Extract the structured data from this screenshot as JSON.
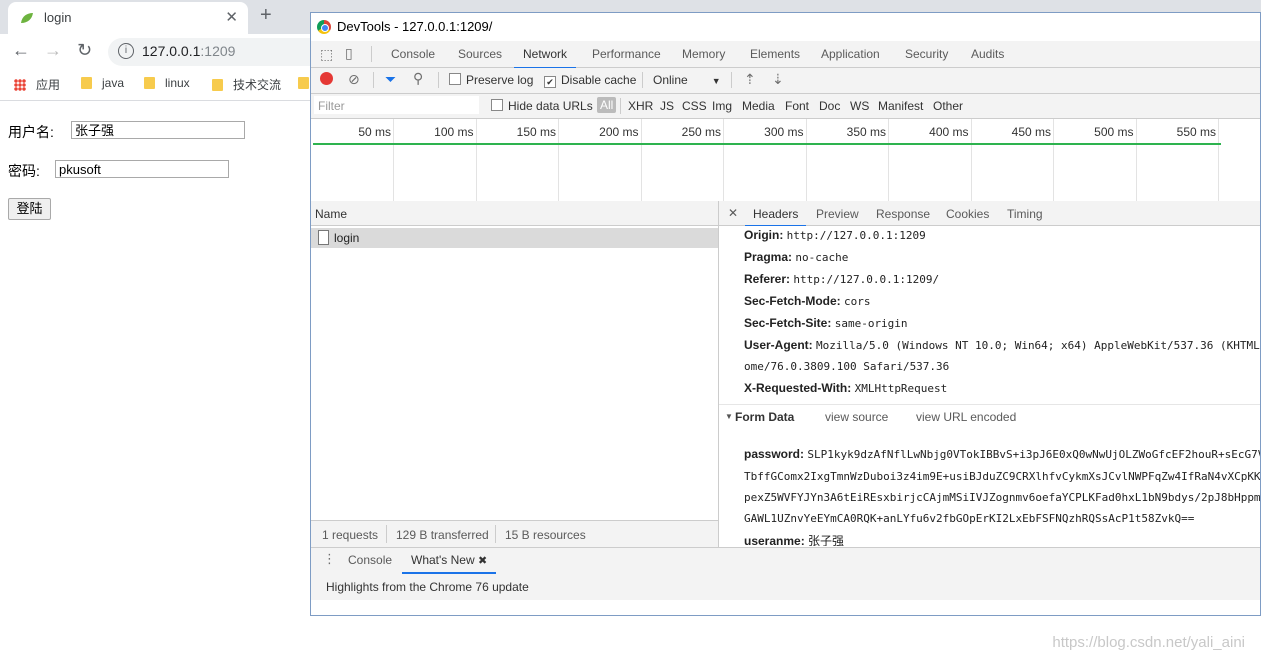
{
  "browser": {
    "tab_title": "login",
    "url_host": "127.0.0.1",
    "url_port": ":1209",
    "bookmarks": [
      "应用",
      "java",
      "linux",
      "技术交流"
    ]
  },
  "page": {
    "username_label": "用户名:",
    "username_value": "张子强",
    "password_label": "密码:",
    "password_value": "pkusoft",
    "login_button": "登陆"
  },
  "devtools": {
    "window_title": "DevTools - 127.0.0.1:1209/",
    "tabs": [
      "Console",
      "Sources",
      "Network",
      "Performance",
      "Memory",
      "Elements",
      "Application",
      "Security",
      "Audits"
    ],
    "selected_tab": "Network",
    "toolbar": {
      "preserve_log": "Preserve log",
      "disable_cache": "Disable cache",
      "throttle": "Online"
    },
    "filter": {
      "placeholder": "Filter",
      "hide_data_urls": "Hide data URLs",
      "types": [
        "All",
        "XHR",
        "JS",
        "CSS",
        "Img",
        "Media",
        "Font",
        "Doc",
        "WS",
        "Manifest",
        "Other"
      ]
    },
    "timeline_ticks": [
      "50 ms",
      "100 ms",
      "150 ms",
      "200 ms",
      "250 ms",
      "300 ms",
      "350 ms",
      "400 ms",
      "450 ms",
      "500 ms",
      "550 ms"
    ],
    "request_list": {
      "column": "Name",
      "rows": [
        "login"
      ],
      "status": {
        "requests": "1 requests",
        "transferred": "129 B transferred",
        "resources": "15 B resources"
      }
    },
    "details": {
      "tabs": [
        "Headers",
        "Preview",
        "Response",
        "Cookies",
        "Timing"
      ],
      "selected_tab": "Headers",
      "headers": [
        {
          "k": "Origin:",
          "v": "http://127.0.0.1:1209"
        },
        {
          "k": "Pragma:",
          "v": "no-cache"
        },
        {
          "k": "Referer:",
          "v": "http://127.0.0.1:1209/"
        },
        {
          "k": "Sec-Fetch-Mode:",
          "v": "cors"
        },
        {
          "k": "Sec-Fetch-Site:",
          "v": "same-origin"
        },
        {
          "k": "User-Agent:",
          "v": "Mozilla/5.0 (Windows NT 10.0; Win64; x64) AppleWebKit/537.36 (KHTML"
        },
        {
          "k": "",
          "v": "ome/76.0.3809.100 Safari/537.36"
        },
        {
          "k": "X-Requested-With:",
          "v": "XMLHttpRequest"
        }
      ],
      "form_data_title": "Form Data",
      "view_source": "view source",
      "view_url_encoded": "view URL encoded",
      "form_data": [
        {
          "k": "password:",
          "v": "SLP1kyk9dzAfNflLwNbjg0VTokIBBvS+i3pJ6E0xQ0wNwUjOLZWoGfcEF2houR+sEcG7V"
        },
        {
          "k": "",
          "v": "TbffGComx2IxgTmnWzDuboi3z4im9E+usiBJduZC9CRXlhfvCykmXsJCvlNWPFqZw4IfRaN4vXCpKK"
        },
        {
          "k": "",
          "v": "pexZ5WVFYJYn3A6tEiREsxbirjcCAjmMSiIVJZognmv6oefaYCPLKFad0hxL1bN9bdys/2pJ8bHppmu"
        },
        {
          "k": "",
          "v": "GAWL1UZnvYeEYmCA0RQK+anLYfu6v2fbGOpErKI2LxEbFSFNQzhRQSsAcP1t58ZvkQ=="
        },
        {
          "k": "useranme:",
          "v": "张子强"
        }
      ]
    },
    "drawer": {
      "tabs": [
        "Console",
        "What's New"
      ],
      "selected_tab": "What's New",
      "message": "Highlights from the Chrome 76 update"
    }
  },
  "watermark": "https://blog.csdn.net/yali_aini"
}
